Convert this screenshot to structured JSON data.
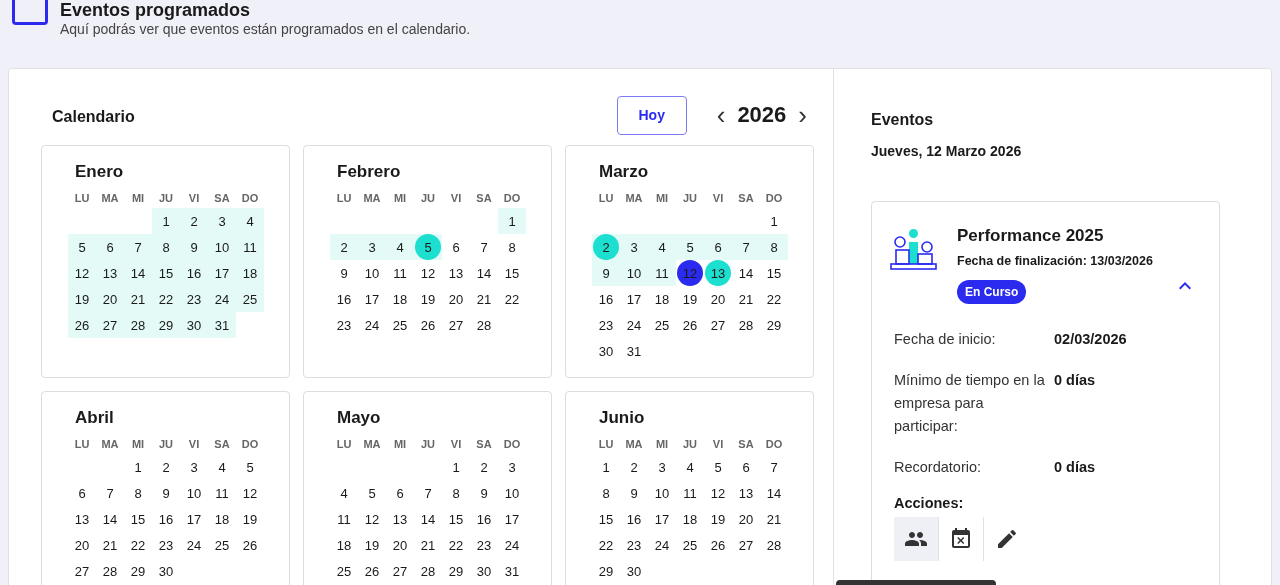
{
  "header": {
    "title": "Eventos programados",
    "subtitle": "Aquí podrás ver que eventos están programados en el calendario."
  },
  "calendar": {
    "title": "Calendario",
    "today_button": "Hoy",
    "prev": "‹",
    "year": "2026",
    "next": "›",
    "months": [
      {
        "name": "Enero",
        "weekdays": [
          "LU",
          "MA",
          "MI",
          "JU",
          "VI",
          "SA",
          "DO"
        ],
        "weeks": [
          [
            {
              "day": "1",
              "in_range": true
            },
            {
              "day": "2",
              "in_range": true
            },
            {
              "day": "3",
              "in_range": true
            },
            {
              "day": "4",
              "in_range": true
            }
          ],
          [
            {
              "day": "5",
              "in_range": true
            },
            {
              "day": "6",
              "in_range": true
            },
            {
              "day": "7",
              "in_range": true
            },
            {
              "day": "8",
              "in_range": true
            },
            {
              "day": "9",
              "in_range": true
            },
            {
              "day": "10",
              "in_range": true
            },
            {
              "day": "11",
              "in_range": true
            }
          ],
          [
            {
              "day": "12",
              "in_range": true
            },
            {
              "day": "13",
              "in_range": true
            },
            {
              "day": "14",
              "in_range": true
            },
            {
              "day": "15",
              "in_range": true
            },
            {
              "day": "16",
              "in_range": true
            },
            {
              "day": "17",
              "in_range": true
            },
            {
              "day": "18",
              "in_range": true
            }
          ],
          [
            {
              "day": "19",
              "in_range": true
            },
            {
              "day": "20",
              "in_range": true
            },
            {
              "day": "21",
              "in_range": true
            },
            {
              "day": "22",
              "in_range": true
            },
            {
              "day": "23",
              "in_range": true
            },
            {
              "day": "24",
              "in_range": true
            },
            {
              "day": "25",
              "in_range": true
            }
          ],
          [
            {
              "day": "26",
              "in_range": true
            },
            {
              "day": "27",
              "in_range": true
            },
            {
              "day": "28",
              "in_range": true
            },
            {
              "day": "29",
              "in_range": true
            },
            {
              "day": "30",
              "in_range": true
            },
            {
              "day": "31",
              "in_range": true
            }
          ]
        ]
      },
      {
        "name": "Febrero",
        "weekdays": [
          "LU",
          "MA",
          "MI",
          "JU",
          "VI",
          "SA",
          "DO"
        ],
        "weeks": [
          [
            {
              "day": "1",
              "in_range": true
            }
          ],
          [
            {
              "day": "2",
              "in_range": true
            },
            {
              "day": "3",
              "in_range": true
            },
            {
              "day": "4",
              "in_range": true
            },
            {
              "day": "5",
              "in_range": true,
              "event": true
            },
            {
              "day": "6",
              "in_range": false
            },
            {
              "day": "7",
              "in_range": false
            },
            {
              "day": "8",
              "in_range": false
            }
          ],
          [
            {
              "day": "9",
              "in_range": false
            },
            {
              "day": "10",
              "in_range": false
            },
            {
              "day": "11",
              "in_range": false
            },
            {
              "day": "12",
              "in_range": false
            },
            {
              "day": "13",
              "in_range": false
            },
            {
              "day": "14",
              "in_range": false
            },
            {
              "day": "15",
              "in_range": false
            }
          ],
          [
            {
              "day": "16",
              "in_range": false
            },
            {
              "day": "17",
              "in_range": false
            },
            {
              "day": "18",
              "in_range": false
            },
            {
              "day": "19",
              "in_range": false
            },
            {
              "day": "20",
              "in_range": false
            },
            {
              "day": "21",
              "in_range": false
            },
            {
              "day": "22",
              "in_range": false
            }
          ],
          [
            {
              "day": "23",
              "in_range": false
            },
            {
              "day": "24",
              "in_range": false
            },
            {
              "day": "25",
              "in_range": false
            },
            {
              "day": "26",
              "in_range": false
            },
            {
              "day": "27",
              "in_range": false
            },
            {
              "day": "28",
              "in_range": false
            }
          ]
        ]
      },
      {
        "name": "Marzo",
        "weekdays": [
          "LU",
          "MA",
          "MI",
          "JU",
          "VI",
          "SA",
          "DO"
        ],
        "weeks": [
          [
            {
              "day": "1",
              "in_range": false
            }
          ],
          [
            {
              "day": "2",
              "in_range": true,
              "event": true
            },
            {
              "day": "3",
              "in_range": true
            },
            {
              "day": "4",
              "in_range": true
            },
            {
              "day": "5",
              "in_range": true
            },
            {
              "day": "6",
              "in_range": true
            },
            {
              "day": "7",
              "in_range": true
            },
            {
              "day": "8",
              "in_range": true
            }
          ],
          [
            {
              "day": "9",
              "in_range": true
            },
            {
              "day": "10",
              "in_range": true
            },
            {
              "day": "11",
              "in_range": true
            },
            {
              "day": "12",
              "in_range": false,
              "today": true
            },
            {
              "day": "13",
              "in_range": false,
              "event": true
            },
            {
              "day": "14",
              "in_range": false
            },
            {
              "day": "15",
              "in_range": false
            }
          ],
          [
            {
              "day": "16",
              "in_range": false
            },
            {
              "day": "17",
              "in_range": false
            },
            {
              "day": "18",
              "in_range": false
            },
            {
              "day": "19",
              "in_range": false
            },
            {
              "day": "20",
              "in_range": false
            },
            {
              "day": "21",
              "in_range": false
            },
            {
              "day": "22",
              "in_range": false
            }
          ],
          [
            {
              "day": "23",
              "in_range": false
            },
            {
              "day": "24",
              "in_range": false
            },
            {
              "day": "25",
              "in_range": false
            },
            {
              "day": "26",
              "in_range": false
            },
            {
              "day": "27",
              "in_range": false
            },
            {
              "day": "28",
              "in_range": false
            },
            {
              "day": "29",
              "in_range": false
            }
          ],
          [
            {
              "day": "30",
              "in_range": false
            },
            {
              "day": "31",
              "in_range": false
            }
          ]
        ]
      },
      {
        "name": "Abril",
        "weekdays": [
          "LU",
          "MA",
          "MI",
          "JU",
          "VI",
          "SA",
          "DO"
        ],
        "weeks": [
          [
            {
              "day": "1",
              "in_range": false
            },
            {
              "day": "2",
              "in_range": false
            },
            {
              "day": "3",
              "in_range": false
            },
            {
              "day": "4",
              "in_range": false
            },
            {
              "day": "5",
              "in_range": false
            }
          ],
          [
            {
              "day": "6",
              "in_range": false
            },
            {
              "day": "7",
              "in_range": false
            },
            {
              "day": "8",
              "in_range": false
            },
            {
              "day": "9",
              "in_range": false
            },
            {
              "day": "10",
              "in_range": false
            },
            {
              "day": "11",
              "in_range": false
            },
            {
              "day": "12",
              "in_range": false
            }
          ],
          [
            {
              "day": "13",
              "in_range": false
            },
            {
              "day": "14",
              "in_range": false
            },
            {
              "day": "15",
              "in_range": false
            },
            {
              "day": "16",
              "in_range": false
            },
            {
              "day": "17",
              "in_range": false
            },
            {
              "day": "18",
              "in_range": false
            },
            {
              "day": "19",
              "in_range": false
            }
          ],
          [
            {
              "day": "20",
              "in_range": false
            },
            {
              "day": "21",
              "in_range": false
            },
            {
              "day": "22",
              "in_range": false
            },
            {
              "day": "23",
              "in_range": false
            },
            {
              "day": "24",
              "in_range": false
            },
            {
              "day": "25",
              "in_range": false
            },
            {
              "day": "26",
              "in_range": false
            }
          ],
          [
            {
              "day": "27",
              "in_range": false
            },
            {
              "day": "28",
              "in_range": false
            },
            {
              "day": "29",
              "in_range": false
            },
            {
              "day": "30",
              "in_range": false
            }
          ]
        ]
      },
      {
        "name": "Mayo",
        "weekdays": [
          "LU",
          "MA",
          "MI",
          "JU",
          "VI",
          "SA",
          "DO"
        ],
        "weeks": [
          [
            {
              "day": "1",
              "in_range": false
            },
            {
              "day": "2",
              "in_range": false
            },
            {
              "day": "3",
              "in_range": false
            }
          ],
          [
            {
              "day": "4",
              "in_range": false
            },
            {
              "day": "5",
              "in_range": false
            },
            {
              "day": "6",
              "in_range": false
            },
            {
              "day": "7",
              "in_range": false
            },
            {
              "day": "8",
              "in_range": false
            },
            {
              "day": "9",
              "in_range": false
            },
            {
              "day": "10",
              "in_range": false
            }
          ],
          [
            {
              "day": "11",
              "in_range": false
            },
            {
              "day": "12",
              "in_range": false
            },
            {
              "day": "13",
              "in_range": false
            },
            {
              "day": "14",
              "in_range": false
            },
            {
              "day": "15",
              "in_range": false
            },
            {
              "day": "16",
              "in_range": false
            },
            {
              "day": "17",
              "in_range": false
            }
          ],
          [
            {
              "day": "18",
              "in_range": false
            },
            {
              "day": "19",
              "in_range": false
            },
            {
              "day": "20",
              "in_range": false
            },
            {
              "day": "21",
              "in_range": false
            },
            {
              "day": "22",
              "in_range": false
            },
            {
              "day": "23",
              "in_range": false
            },
            {
              "day": "24",
              "in_range": false
            }
          ],
          [
            {
              "day": "25",
              "in_range": false
            },
            {
              "day": "26",
              "in_range": false
            },
            {
              "day": "27",
              "in_range": false
            },
            {
              "day": "28",
              "in_range": false
            },
            {
              "day": "29",
              "in_range": false
            },
            {
              "day": "30",
              "in_range": false
            },
            {
              "day": "31",
              "in_range": false
            }
          ]
        ]
      },
      {
        "name": "Junio",
        "weekdays": [
          "LU",
          "MA",
          "MI",
          "JU",
          "VI",
          "SA",
          "DO"
        ],
        "weeks": [
          [
            {
              "day": "1",
              "in_range": false
            },
            {
              "day": "2",
              "in_range": false
            },
            {
              "day": "3",
              "in_range": false
            },
            {
              "day": "4",
              "in_range": false
            },
            {
              "day": "5",
              "in_range": false
            },
            {
              "day": "6",
              "in_range": false
            },
            {
              "day": "7",
              "in_range": false
            }
          ],
          [
            {
              "day": "8",
              "in_range": false
            },
            {
              "day": "9",
              "in_range": false
            },
            {
              "day": "10",
              "in_range": false
            },
            {
              "day": "11",
              "in_range": false
            },
            {
              "day": "12",
              "in_range": false
            },
            {
              "day": "13",
              "in_range": false
            },
            {
              "day": "14",
              "in_range": false
            }
          ],
          [
            {
              "day": "15",
              "in_range": false
            },
            {
              "day": "16",
              "in_range": false
            },
            {
              "day": "17",
              "in_range": false
            },
            {
              "day": "18",
              "in_range": false
            },
            {
              "day": "19",
              "in_range": false
            },
            {
              "day": "20",
              "in_range": false
            },
            {
              "day": "21",
              "in_range": false
            }
          ],
          [
            {
              "day": "22",
              "in_range": false
            },
            {
              "day": "23",
              "in_range": false
            },
            {
              "day": "24",
              "in_range": false
            },
            {
              "day": "25",
              "in_range": false
            },
            {
              "day": "26",
              "in_range": false
            },
            {
              "day": "27",
              "in_range": false
            },
            {
              "day": "28",
              "in_range": false
            }
          ],
          [
            {
              "day": "29",
              "in_range": false
            },
            {
              "day": "30",
              "in_range": false
            }
          ]
        ]
      }
    ]
  },
  "events": {
    "title": "Eventos",
    "date": "Jueves, 12 Marzo 2026",
    "event": {
      "title": "Performance 2025",
      "end_date": "Fecha de finalización: 13/03/2026",
      "expanded": true,
      "status": "En Curso",
      "details": [
        {
          "label": "Fecha de inicio:",
          "value": "02/03/2026"
        },
        {
          "label": "Mínimo de tiempo en la empresa para participar:",
          "value": "0 días"
        },
        {
          "label": "Recordatorio:",
          "value": "0 días"
        }
      ],
      "actions_label": "Acciones:",
      "actions": [
        {
          "kind": "participants",
          "selected": true
        },
        {
          "kind": "cancel",
          "selected": false
        },
        {
          "kind": "edit",
          "selected": false
        }
      ]
    }
  },
  "tooltip": {
    "kind": "tooltip"
  }
}
